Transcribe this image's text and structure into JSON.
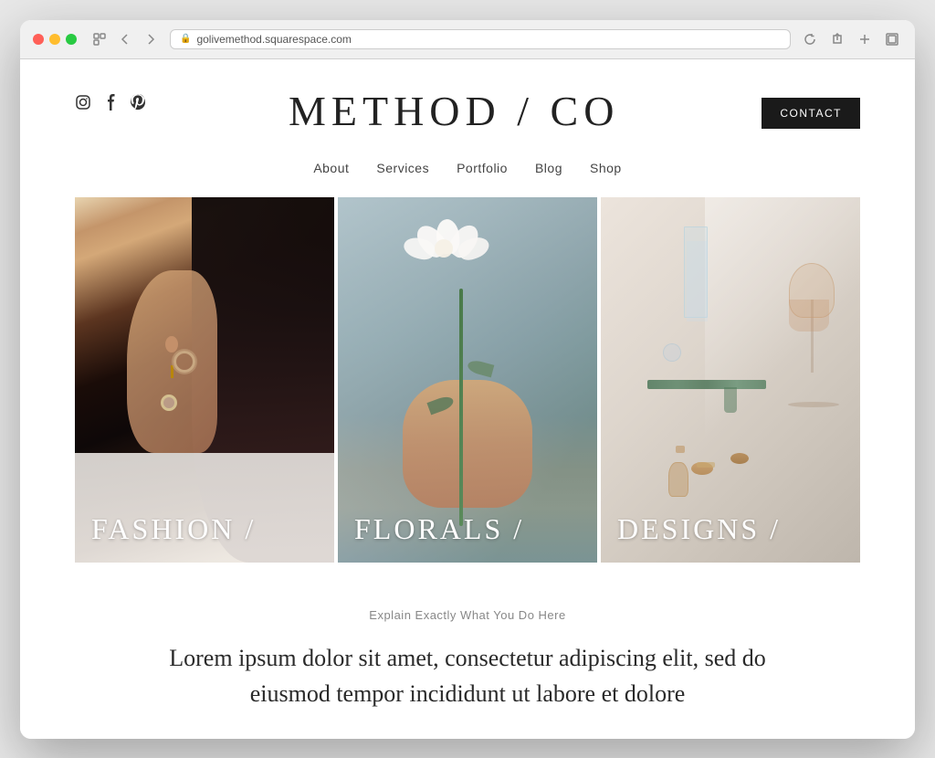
{
  "browser": {
    "url": "golivemethod.squarespace.com",
    "reload_label": "↻"
  },
  "header": {
    "title": "METHOD / CO",
    "contact_button": "CONTACT"
  },
  "social": {
    "instagram": "IG",
    "facebook": "f",
    "pinterest": "P"
  },
  "nav": {
    "items": [
      {
        "label": "About",
        "id": "about"
      },
      {
        "label": "Services",
        "id": "services"
      },
      {
        "label": "Portfolio",
        "id": "portfolio"
      },
      {
        "label": "Blog",
        "id": "blog"
      },
      {
        "label": "Shop",
        "id": "shop"
      }
    ]
  },
  "gallery": {
    "items": [
      {
        "label": "FASHION /",
        "id": "fashion"
      },
      {
        "label": "FLORALS /",
        "id": "florals"
      },
      {
        "label": "DESIGNS /",
        "id": "designs"
      }
    ]
  },
  "section": {
    "subtitle": "Explain Exactly What You Do Here",
    "body_text": "Lorem ipsum dolor sit amet, consectetur adipiscing elit, sed do eiusmod tempor incididunt ut labore et dolore"
  }
}
